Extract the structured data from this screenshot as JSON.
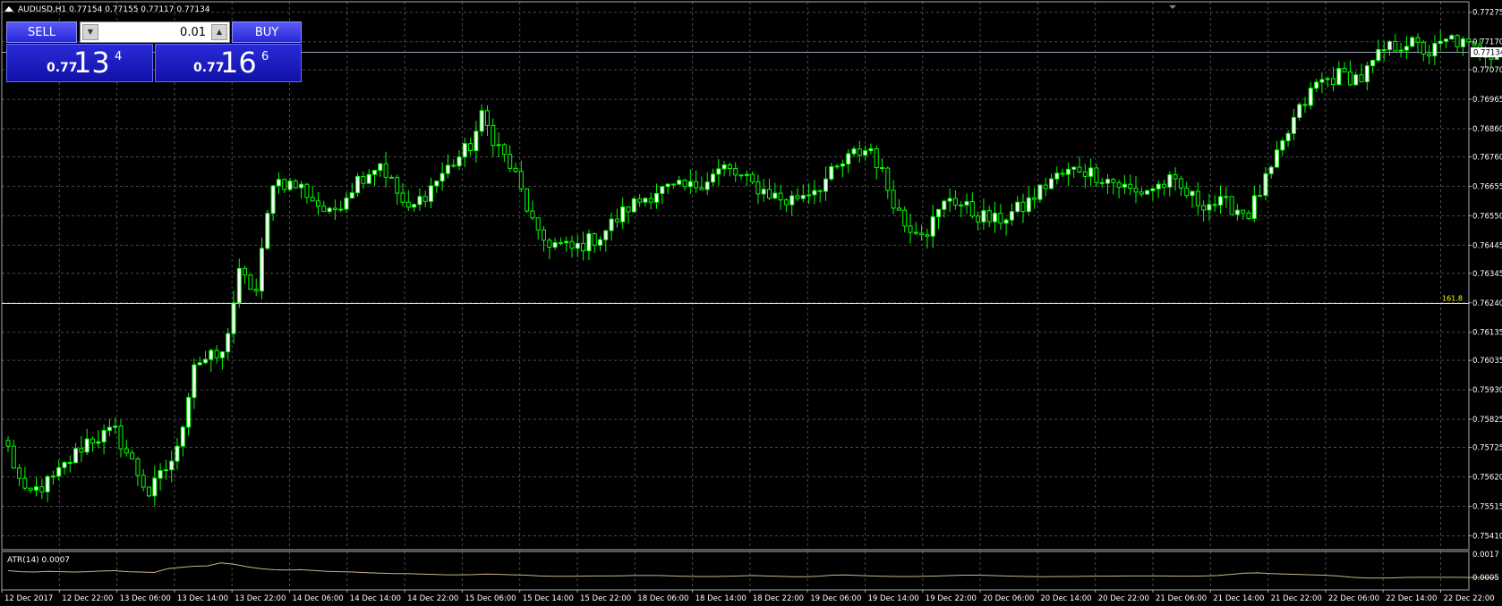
{
  "symbol_line": "AUDUSD,H1  0.77154 0.77155 0.77117 0.77134",
  "trade_panel": {
    "sell_label": "SELL",
    "buy_label": "BUY",
    "lot": "0.01",
    "sell_price_prefix": "0.77",
    "sell_price_big": "13",
    "sell_price_sup": "4",
    "buy_price_prefix": "0.77",
    "buy_price_big": "16",
    "buy_price_sup": "6"
  },
  "colors": {
    "background": "#000000",
    "grid": "#4a4a4a",
    "axis_text": "#ffffff",
    "bull_candle": "#ffffff",
    "bear_candle": "#000000",
    "candle_wick": "#00ff00",
    "fib_line": "#ffff00",
    "bid_line": "#9aa4b8",
    "atr_line": "#c8b48a",
    "trade_button": "#2a2bd8"
  },
  "chart_data": [
    {
      "type": "candlestick",
      "title": "AUDUSD,H1  0.77154 0.77155 0.77117 0.77134",
      "ylim": [
        0.7537,
        0.7729
      ],
      "y_ticks": [
        "0.77275",
        "0.77170",
        "0.77070",
        "0.76965",
        "0.76860",
        "0.76760",
        "0.76655",
        "0.76550",
        "0.76445",
        "0.76345",
        "0.76240",
        "0.76135",
        "0.76035",
        "0.75930",
        "0.75825",
        "0.75725",
        "0.75620",
        "0.75515",
        "0.75410"
      ],
      "x_ticks": [
        "12 Dec 2017",
        "12 Dec 22:00",
        "13 Dec 06:00",
        "13 Dec 14:00",
        "13 Dec 22:00",
        "14 Dec 06:00",
        "14 Dec 14:00",
        "14 Dec 22:00",
        "15 Dec 06:00",
        "15 Dec 14:00",
        "15 Dec 22:00",
        "18 Dec 06:00",
        "18 Dec 14:00",
        "18 Dec 22:00",
        "19 Dec 06:00",
        "19 Dec 14:00",
        "19 Dec 22:00",
        "20 Dec 06:00",
        "20 Dec 14:00",
        "20 Dec 22:00",
        "21 Dec 06:00",
        "21 Dec 14:00",
        "21 Dec 22:00",
        "22 Dec 06:00",
        "22 Dec 14:00",
        "22 Dec 22:00"
      ],
      "current_price": "0.77134",
      "horizontal_lines": [
        {
          "label": "161.8",
          "value": 0.7624
        }
      ],
      "approx_close_path": [
        {
          "bar": 0,
          "close": 0.7572
        },
        {
          "bar": 3,
          "close": 0.7555
        },
        {
          "bar": 8,
          "close": 0.7561
        },
        {
          "bar": 14,
          "close": 0.7575
        },
        {
          "bar": 19,
          "close": 0.7578
        },
        {
          "bar": 25,
          "close": 0.7556
        },
        {
          "bar": 30,
          "close": 0.7571
        },
        {
          "bar": 33,
          "close": 0.7603
        },
        {
          "bar": 38,
          "close": 0.7605
        },
        {
          "bar": 41,
          "close": 0.7634
        },
        {
          "bar": 44,
          "close": 0.7628
        },
        {
          "bar": 47,
          "close": 0.7668
        },
        {
          "bar": 52,
          "close": 0.7665
        },
        {
          "bar": 57,
          "close": 0.7655
        },
        {
          "bar": 62,
          "close": 0.7668
        },
        {
          "bar": 66,
          "close": 0.7674
        },
        {
          "bar": 71,
          "close": 0.7656
        },
        {
          "bar": 77,
          "close": 0.767
        },
        {
          "bar": 82,
          "close": 0.768
        },
        {
          "bar": 84,
          "close": 0.769
        },
        {
          "bar": 90,
          "close": 0.7669
        },
        {
          "bar": 94,
          "close": 0.7647
        },
        {
          "bar": 100,
          "close": 0.7643
        },
        {
          "bar": 105,
          "close": 0.7648
        },
        {
          "bar": 110,
          "close": 0.7658
        },
        {
          "bar": 115,
          "close": 0.7664
        },
        {
          "bar": 121,
          "close": 0.7665
        },
        {
          "bar": 127,
          "close": 0.7672
        },
        {
          "bar": 132,
          "close": 0.7666
        },
        {
          "bar": 138,
          "close": 0.766
        },
        {
          "bar": 144,
          "close": 0.7666
        },
        {
          "bar": 150,
          "close": 0.7677
        },
        {
          "bar": 153,
          "close": 0.7679
        },
        {
          "bar": 156,
          "close": 0.7665
        },
        {
          "bar": 159,
          "close": 0.7652
        },
        {
          "bar": 163,
          "close": 0.765
        },
        {
          "bar": 167,
          "close": 0.7662
        },
        {
          "bar": 171,
          "close": 0.7656
        },
        {
          "bar": 175,
          "close": 0.7653
        },
        {
          "bar": 180,
          "close": 0.7658
        },
        {
          "bar": 185,
          "close": 0.7668
        },
        {
          "bar": 190,
          "close": 0.7672
        },
        {
          "bar": 195,
          "close": 0.7668
        },
        {
          "bar": 200,
          "close": 0.7663
        },
        {
          "bar": 206,
          "close": 0.7667
        },
        {
          "bar": 211,
          "close": 0.766
        },
        {
          "bar": 216,
          "close": 0.7659
        },
        {
          "bar": 220,
          "close": 0.7656
        },
        {
          "bar": 224,
          "close": 0.7671
        },
        {
          "bar": 228,
          "close": 0.7689
        },
        {
          "bar": 232,
          "close": 0.7702
        },
        {
          "bar": 236,
          "close": 0.7705
        },
        {
          "bar": 240,
          "close": 0.7704
        },
        {
          "bar": 244,
          "close": 0.7714
        },
        {
          "bar": 248,
          "close": 0.7717
        },
        {
          "bar": 252,
          "close": 0.7713
        },
        {
          "bar": 256,
          "close": 0.7718
        },
        {
          "bar": 260,
          "close": 0.7714
        },
        {
          "bar": 264,
          "close": 0.7713
        }
      ],
      "total_bars": 265,
      "grid": true
    },
    {
      "type": "line",
      "title": "ATR(14) 0.0007",
      "series": [
        {
          "name": "ATR(14)",
          "values": [
            0.00085,
            0.0008,
            0.00078,
            0.00082,
            0.0008,
            0.00078,
            0.0008,
            0.00083,
            0.00085,
            0.0008,
            0.00078,
            0.00076,
            0.00095,
            0.00102,
            0.00108,
            0.0011,
            0.00125,
            0.00118,
            0.00105,
            0.00095,
            0.0009,
            0.00088,
            0.0009,
            0.00086,
            0.00082,
            0.0008,
            0.00078,
            0.00075,
            0.00072,
            0.0007,
            0.0007,
            0.00068,
            0.00066,
            0.00064,
            0.00064,
            0.00065,
            0.00068,
            0.00066,
            0.00064,
            0.00062,
            0.00058,
            0.00056,
            0.00056,
            0.00057,
            0.00058,
            0.00058,
            0.00059,
            0.0006,
            0.0006,
            0.0006,
            0.00058,
            0.00056,
            0.00055,
            0.00055,
            0.00056,
            0.00058,
            0.0006,
            0.00058,
            0.00056,
            0.00054,
            0.00054,
            0.00057,
            0.00062,
            0.00063,
            0.0006,
            0.00058,
            0.00056,
            0.00055,
            0.00055,
            0.00056,
            0.00058,
            0.0006,
            0.00062,
            0.00062,
            0.0006,
            0.00058,
            0.00056,
            0.00055,
            0.00054,
            0.00055,
            0.00055,
            0.00056,
            0.00057,
            0.00057,
            0.00058,
            0.00058,
            0.00058,
            0.00058,
            0.00057,
            0.00057,
            0.00058,
            0.0006,
            0.00066,
            0.00072,
            0.00074,
            0.0007,
            0.00068,
            0.00066,
            0.00064,
            0.00062,
            0.00058,
            0.00052,
            0.00048,
            0.00047,
            0.00048,
            0.0005,
            0.00051,
            0.00051,
            0.00051,
            0.00051,
            0.0005,
            0.0005,
            0.00048
          ]
        }
      ],
      "y_ticks": [
        "0.0017",
        "0.0005"
      ],
      "ylim": [
        0.0,
        0.0017
      ],
      "grid": true
    }
  ]
}
